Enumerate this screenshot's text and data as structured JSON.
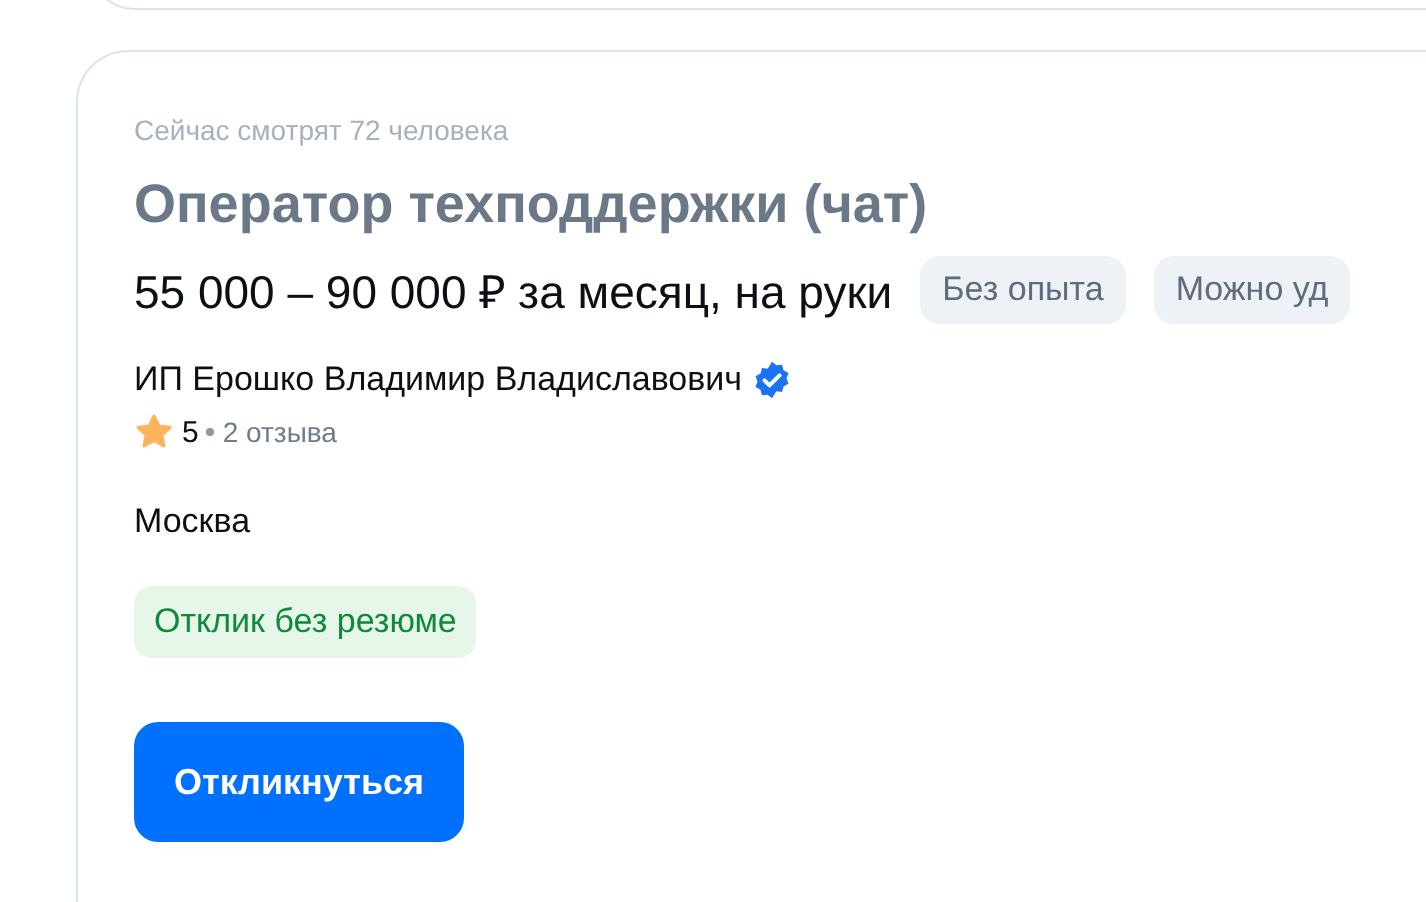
{
  "vacancy": {
    "viewers": "Сейчас смотрят 72 человека",
    "title": "Оператор техподдержки (чат)",
    "salary": "55 000 – 90 000 ₽ за месяц, на руки",
    "tags": [
      "Без опыта",
      "Можно уд"
    ],
    "employer": {
      "name": "ИП Ерошко Владимир Владиславович",
      "verified": true,
      "rating": "5",
      "reviews": "2 отзыва"
    },
    "city": "Москва",
    "badge": "Отклик без резюме",
    "button": "Откликнуться"
  }
}
